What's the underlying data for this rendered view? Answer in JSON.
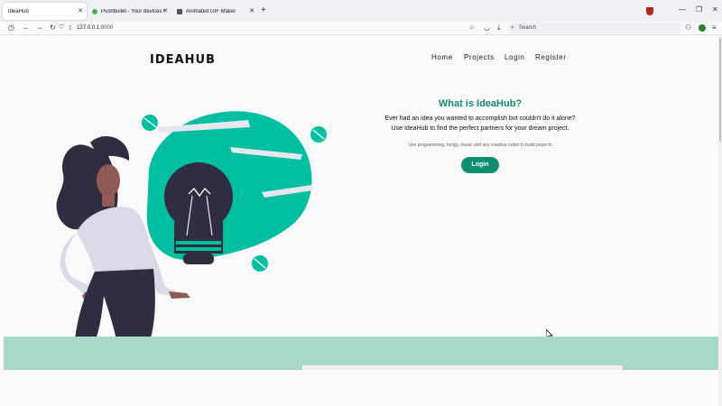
{
  "browser": {
    "tabs": [
      {
        "title": "IdeaHub",
        "active": true
      },
      {
        "title": "Pushbullet - Your devices worki"
      },
      {
        "title": "Animated GIF Maker"
      }
    ],
    "url_host": "127.0.0.1",
    "url_port": ":8000",
    "search_placeholder": "Search"
  },
  "nav": {
    "logo": "IDEAHUB",
    "items": [
      "Home",
      "Projects",
      "Login",
      "Register"
    ]
  },
  "hero": {
    "title": "What is IdeaHub?",
    "line1": "Ever had an idea you wanted to accomplish but couldn't do it alone?",
    "line2": "Use IdeaHub to find the perfect partners for your dream project.",
    "small": "Use programming, biolgy, music and any creative outlet to build projects",
    "button": "Login"
  },
  "colors": {
    "brand": "#0e8f6e",
    "accent_teal": "#00bfa0",
    "band": "#a7d8c8"
  }
}
